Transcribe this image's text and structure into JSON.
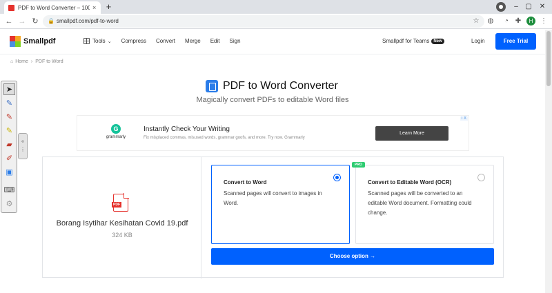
{
  "browser": {
    "tab_title": "PDF to Word Converter – 100% Fr",
    "tab_close": "×",
    "new_tab": "+",
    "url": "smallpdf.com/pdf-to-word",
    "profile_initial": "H"
  },
  "header": {
    "logo": "Smallpdf",
    "nav": {
      "tools": "Tools",
      "compress": "Compress",
      "convert": "Convert",
      "merge": "Merge",
      "edit": "Edit",
      "sign": "Sign"
    },
    "teams": "Smallpdf for Teams",
    "teams_badge": "New",
    "login": "Login",
    "free_trial": "Free Trial"
  },
  "breadcrumb": {
    "home": "Home",
    "current": "PDF to Word"
  },
  "hero": {
    "title": "PDF to Word Converter",
    "subtitle": "Magically convert PDFs to editable Word files"
  },
  "ad": {
    "brand": "grammarly",
    "headline": "Instantly Check Your Writing",
    "description": "Fix misplaced commas, misused words, grammar goofs, and more. Try now. Grammarly",
    "cta": "Learn More",
    "close": "i X"
  },
  "file": {
    "name": "Borang Isytihar Kesihatan Covid 19.pdf",
    "size": "324 KB",
    "icon_label": "PDF"
  },
  "options": [
    {
      "title": "Convert to Word",
      "description": "Scanned pages will convert to images in Word.",
      "selected": true
    },
    {
      "title": "Convert to Editable Word (OCR)",
      "description": "Scanned pages will be converted to an editable Word document. Formatting could change.",
      "badge": "PRO",
      "selected": false
    }
  ],
  "choose_button": "Choose option →",
  "colors": {
    "accent": "#0061fe",
    "pdf_red": "#e5322d",
    "pro_green": "#2ecc71"
  }
}
